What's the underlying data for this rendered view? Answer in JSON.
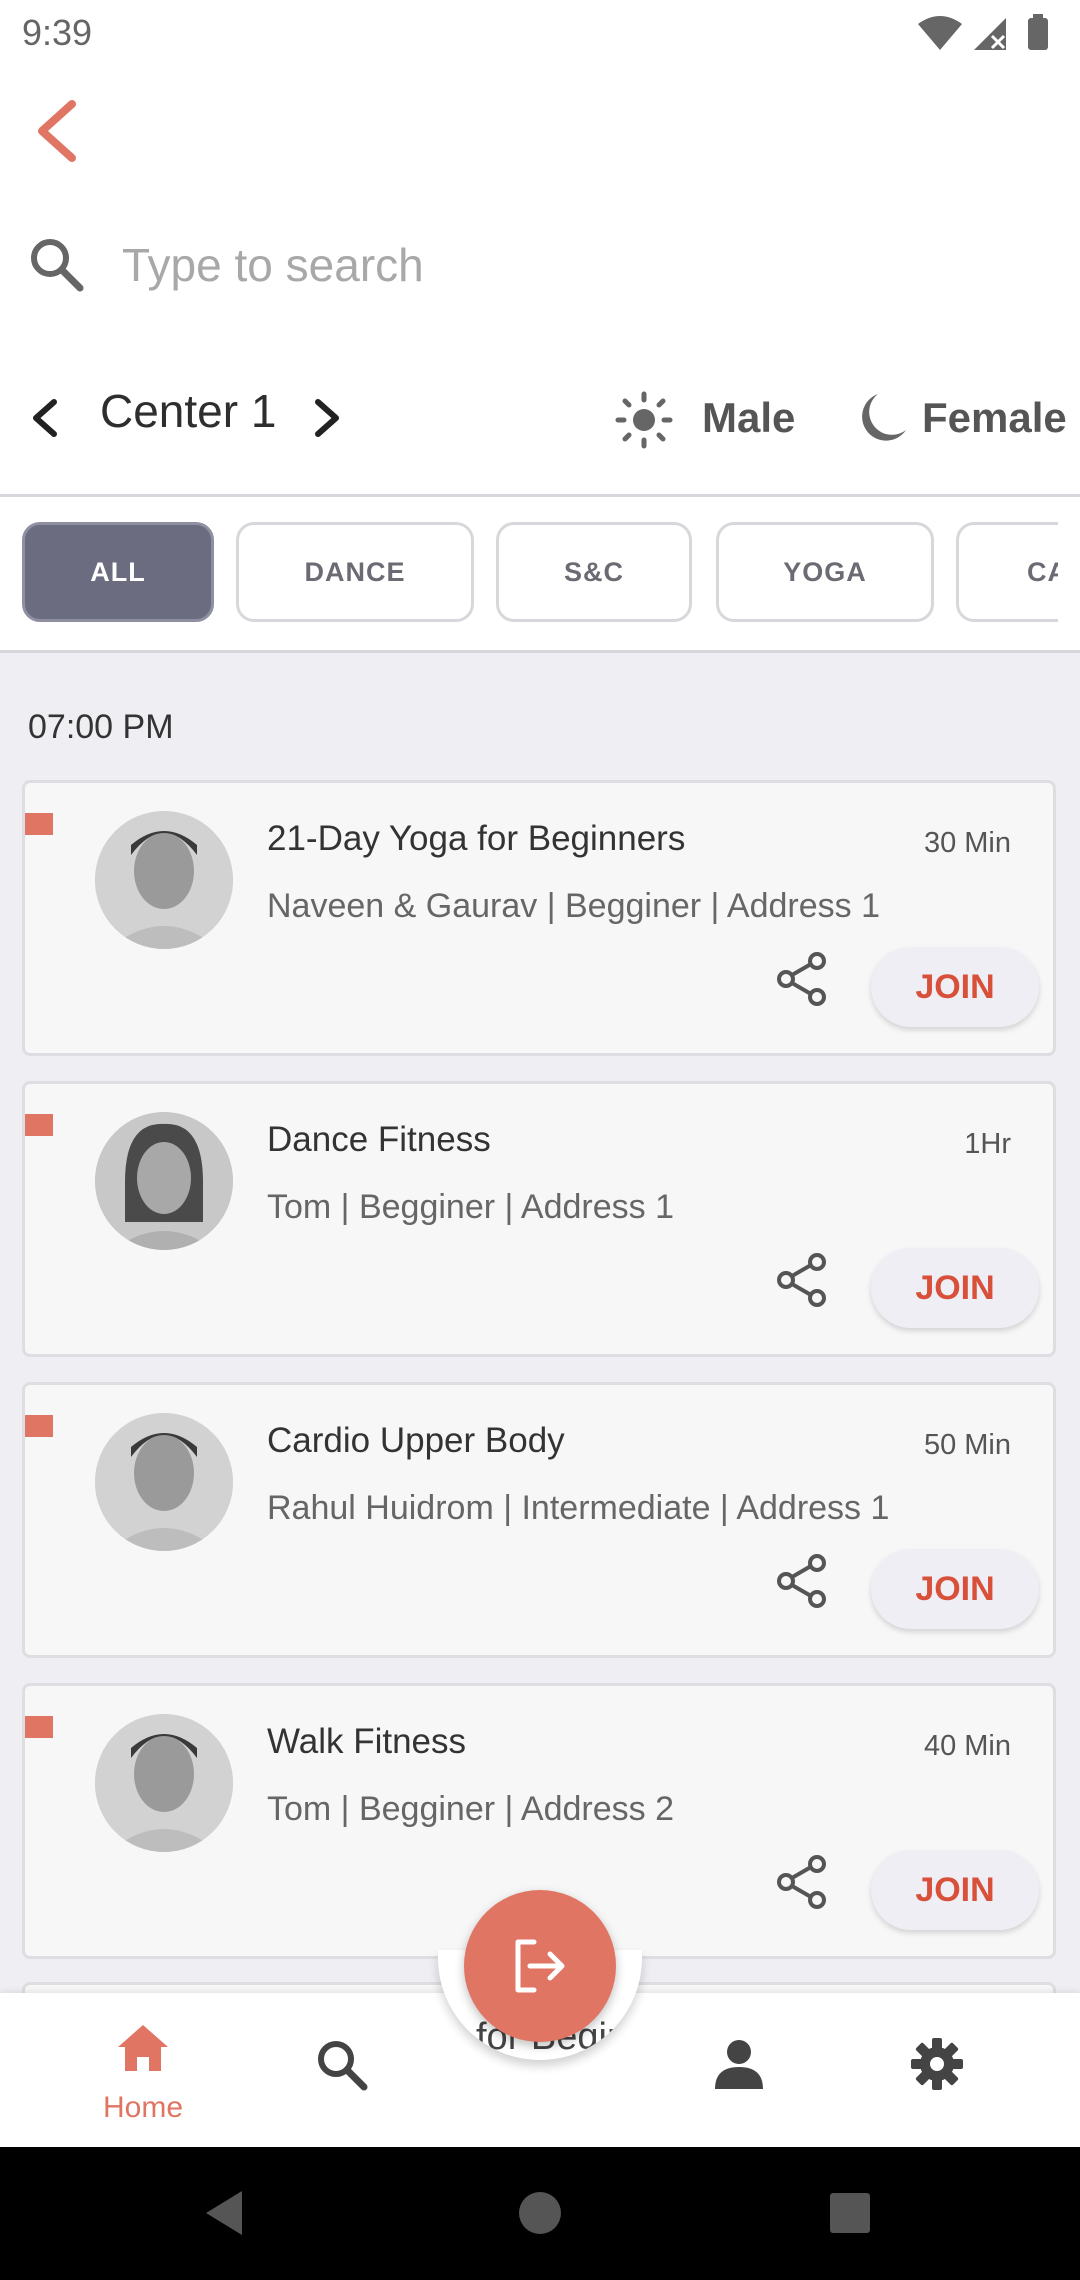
{
  "status_bar": {
    "time": "9:39"
  },
  "search": {
    "placeholder": "Type to search"
  },
  "center": {
    "name": "Center 1"
  },
  "gender": {
    "male": "Male",
    "female": "Female"
  },
  "categories": [
    {
      "label": "ALL",
      "active": true
    },
    {
      "label": "DANCE",
      "active": false
    },
    {
      "label": "S&C",
      "active": false
    },
    {
      "label": "YOGA",
      "active": false
    },
    {
      "label": "CA",
      "active": false
    }
  ],
  "schedule": {
    "time_header": "07:00 PM",
    "classes": [
      {
        "title": "21-Day Yoga for Beginners",
        "duration": "30 Min",
        "subtitle": "Naveen & Gaurav | Begginer | Address 1",
        "join_label": "JOIN"
      },
      {
        "title": "Dance Fitness",
        "duration": "1Hr",
        "subtitle": "Tom | Begginer | Address 1",
        "join_label": "JOIN"
      },
      {
        "title": "Cardio Upper Body",
        "duration": "50 Min",
        "subtitle": "Rahul Huidrom | Intermediate | Address 1",
        "join_label": "JOIN"
      },
      {
        "title": "Walk Fitness",
        "duration": "40 Min",
        "subtitle": "Tom | Begginer | Address 2",
        "join_label": "JOIN"
      }
    ],
    "partial_text": "for Begin"
  },
  "bottom_nav": {
    "home_label": "Home",
    "items": [
      "home-icon",
      "search-icon",
      "person-icon",
      "gear-icon"
    ]
  },
  "fab": {
    "icon": "logout-icon"
  },
  "colors": {
    "accent": "#e07563",
    "join_text": "#d8503a",
    "chip_active": "#6b6c80"
  }
}
